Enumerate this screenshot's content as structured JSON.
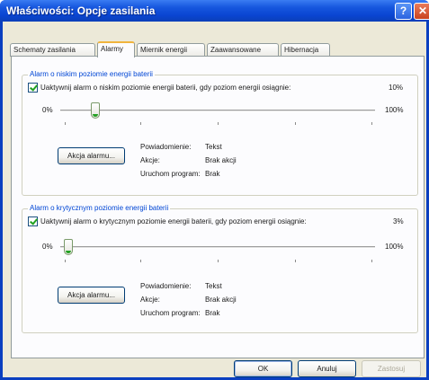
{
  "window": {
    "title": "Właściwości: Opcje zasilania",
    "help_glyph": "?",
    "close_glyph": "✕"
  },
  "tabs": [
    {
      "label": "Schematy zasilania"
    },
    {
      "label": "Alarmy"
    },
    {
      "label": "Miernik energii"
    },
    {
      "label": "Zaawansowane"
    },
    {
      "label": "Hibernacja"
    }
  ],
  "active_tab": "Alarmy",
  "low_alarm": {
    "group_label": "Alarm o niskim poziomie energii baterii",
    "checkbox_label": "Uaktywnij alarm o niskim poziomie energii baterii, gdy poziom energii osiągnie:",
    "checked": true,
    "value_text": "10%",
    "value": 10,
    "min_label": "0%",
    "max_label": "100%",
    "action_button": "Akcja alarmu...",
    "notification_label": "Powiadomienie:",
    "notification_value": "Tekst",
    "actions_label": "Akcje:",
    "actions_value": "Brak akcji",
    "program_label": "Uruchom program:",
    "program_value": "Brak"
  },
  "critical_alarm": {
    "group_label": "Alarm o krytycznym poziomie energii baterii",
    "checkbox_label": "Uaktywnij alarm o krytycznym poziomie energii baterii, gdy poziom energii osiągnie:",
    "checked": true,
    "value_text": "3%",
    "value": 3,
    "min_label": "0%",
    "max_label": "100%",
    "action_button": "Akcja alarmu...",
    "notification_label": "Powiadomienie:",
    "notification_value": "Tekst",
    "actions_label": "Akcje:",
    "actions_value": "Brak akcji",
    "program_label": "Uruchom program:",
    "program_value": "Brak"
  },
  "footer": {
    "ok": "OK",
    "cancel": "Anuluj",
    "apply": "Zastosuj"
  },
  "colors": {
    "title_bar": "#0a45d2",
    "group_label": "#0046d5",
    "checkmark": "#21a121",
    "dialog_bg": "#ece9d8"
  }
}
